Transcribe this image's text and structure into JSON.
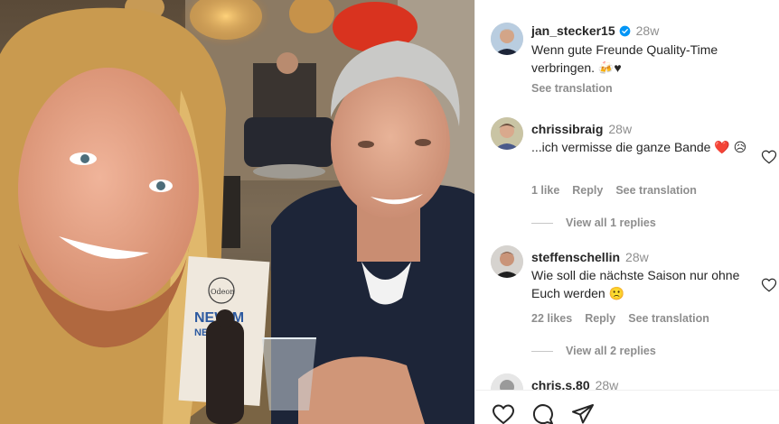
{
  "post": {
    "author": "jan_stecker15",
    "time": "28w",
    "caption_line1": "Wenn gute Freunde Quality-Time",
    "caption_line2": "verbringen. 🍻♥",
    "see_translation": "See translation"
  },
  "photo": {
    "menu_card_line1": "NEW M",
    "menu_card_line2": "NEW M",
    "menu_card_logo": "Odeon"
  },
  "comments": [
    {
      "username": "chrissibraig",
      "time": "28w",
      "text": "...ich vermisse die ganze Bande ❤️ 😥",
      "likes": "1 like",
      "reply": "Reply",
      "see_translation": "See translation",
      "view_replies": "View all 1 replies"
    },
    {
      "username": "steffenschellin",
      "time": "28w",
      "text": "Wie soll die nächste Saison nur ohne Euch werden 🙁",
      "likes": "22 likes",
      "reply": "Reply",
      "see_translation": "See translation",
      "view_replies": "View all 2 replies"
    },
    {
      "username": "chris.s.80",
      "time": "28w"
    }
  ],
  "icons": {
    "verified": "verified-badge-icon",
    "like": "heart-outline-icon",
    "comment": "comment-icon",
    "share": "share-icon",
    "brand_blue": "#0095f6",
    "heart_red": "#ed4956"
  }
}
